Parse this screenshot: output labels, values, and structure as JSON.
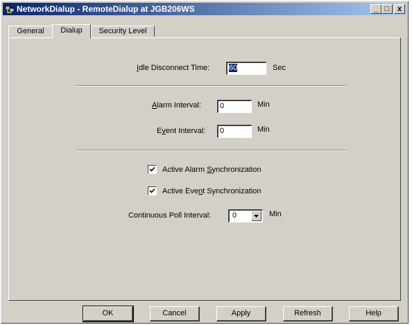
{
  "window": {
    "title": "NetworkDialup - RemoteDialup at JGB206WS",
    "minimize_glyph": "_",
    "maximize_glyph": "□",
    "close_glyph": "x",
    "icon": "network-app-icon"
  },
  "tabs": [
    {
      "label": "General",
      "active": false
    },
    {
      "label": "Dialup",
      "active": true
    },
    {
      "label": "Security Level",
      "active": false
    }
  ],
  "idle": {
    "label_pre": "",
    "label_ul": "I",
    "label_post": "dle Disconnect Time:",
    "value": "60",
    "unit": "Sec"
  },
  "alarm": {
    "label_pre": "",
    "label_ul": "A",
    "label_post": "larm Interval:",
    "value": "0",
    "unit": "Min"
  },
  "event": {
    "label_pre": "E",
    "label_ul": "v",
    "label_post": "ent Interval:",
    "value": "0",
    "unit": "Min"
  },
  "alarm_sync": {
    "label_pre": "Active Alarm ",
    "label_ul": "S",
    "label_post": "ynchronization",
    "checked": true
  },
  "event_sync": {
    "label_pre": "Active Eve",
    "label_ul": "n",
    "label_post": "t Synchronization",
    "checked": true
  },
  "poll": {
    "label": "Continuous Poll Interval:",
    "value": "0",
    "unit": "Min"
  },
  "buttons": {
    "ok": "OK",
    "cancel": "Cancel",
    "apply": "Apply",
    "refresh": "Refresh",
    "help": "Help"
  },
  "colors": {
    "titlebar_start": "#0a246a",
    "titlebar_end": "#a6caf0",
    "face": "#d4d0c8"
  }
}
